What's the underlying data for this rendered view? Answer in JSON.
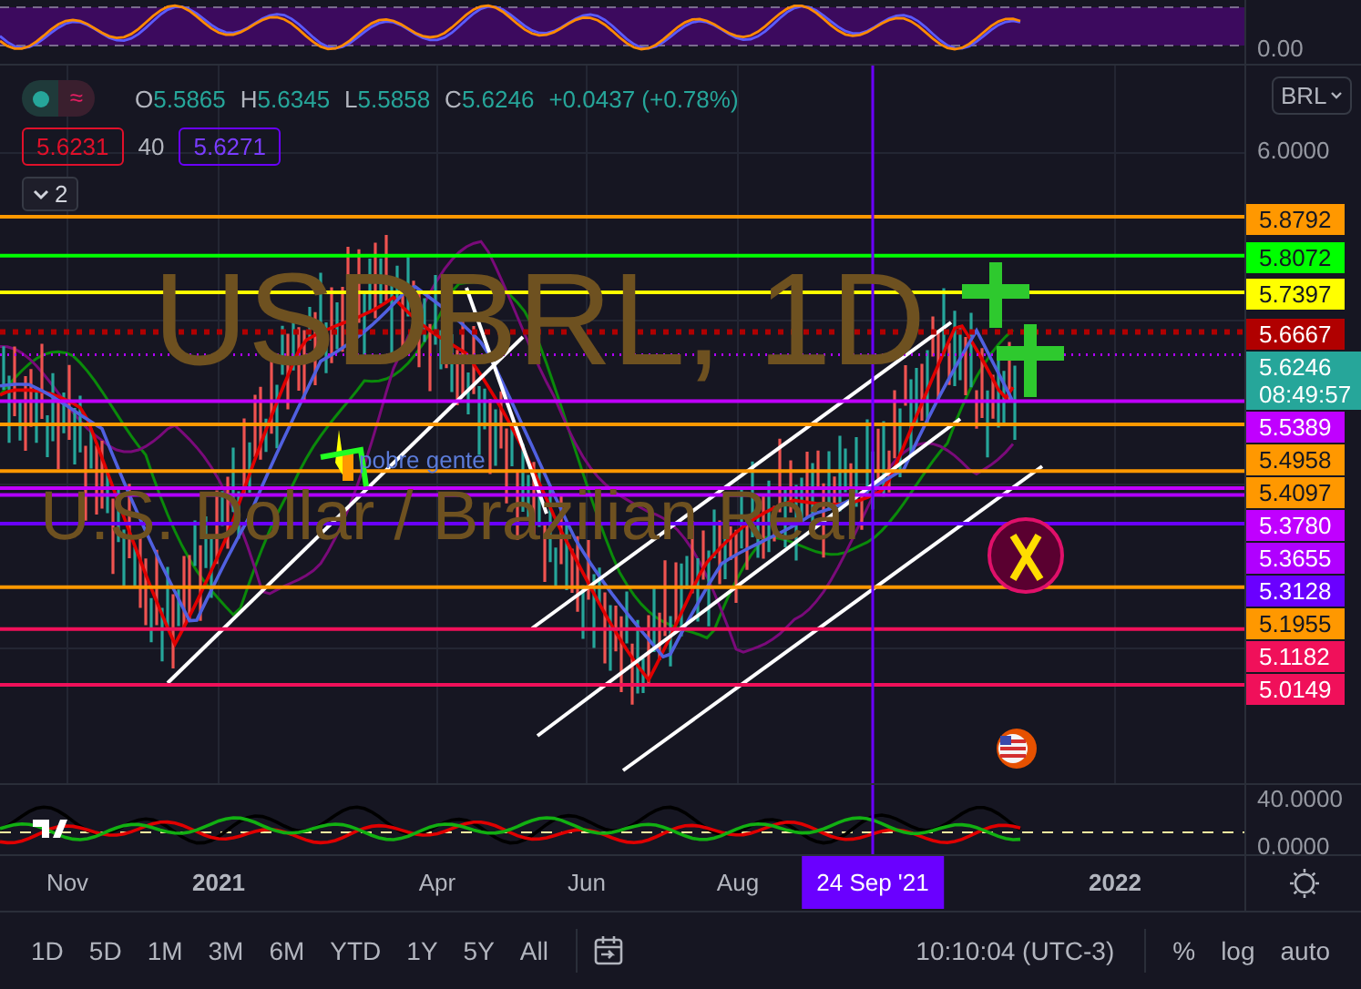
{
  "oscillator": {
    "axis_label": "0.00"
  },
  "legend": {
    "toggle_symbol": "≈",
    "ohlc": [
      {
        "label": "O",
        "value": "5.5865"
      },
      {
        "label": "H",
        "value": "5.6345"
      },
      {
        "label": "L",
        "value": "5.5858"
      },
      {
        "label": "C",
        "value": "5.6246"
      }
    ],
    "change": "+0.0437 (+0.78%)",
    "bid": "5.6231",
    "spread": "40",
    "ask": "5.6271",
    "collapse_count": "2"
  },
  "symbol_watermark": {
    "ticker": "USDBRL, 1D",
    "description": "U.S. Dollar / Brazilian Real"
  },
  "drawing_label": "pobre gente",
  "price_axis": {
    "currency": "BRL",
    "top_label": "6.0000"
  },
  "price_levels": [
    {
      "price": "5.8792",
      "color": "#ff9800",
      "kind": "solid"
    },
    {
      "price": "5.8072",
      "color": "#00ff00",
      "kind": "solid"
    },
    {
      "price": "5.7397",
      "color": "#ffff00",
      "kind": "solid"
    },
    {
      "price": "5.6667",
      "color": "#b00000",
      "kind": "dotted"
    },
    {
      "price": "5.5389",
      "color": "#c000ff",
      "kind": "solid"
    },
    {
      "price": "5.4958",
      "color": "#ff9800",
      "kind": "solid"
    },
    {
      "price": "5.4097",
      "color": "#ff9800",
      "kind": "solid"
    },
    {
      "price": "5.3780",
      "color": "#c000ff",
      "kind": "solid"
    },
    {
      "price": "5.3655",
      "color": "#b000ff",
      "kind": "solid"
    },
    {
      "price": "5.3128",
      "color": "#6a00ff",
      "kind": "solid"
    },
    {
      "price": "5.1955",
      "color": "#ff9800",
      "kind": "solid"
    },
    {
      "price": "5.1182",
      "color": "#f0105a",
      "kind": "solid"
    },
    {
      "price": "5.0149",
      "color": "#f0105a",
      "kind": "solid"
    }
  ],
  "current_price": {
    "price": "5.6246",
    "countdown": "08:49:57",
    "color": "#26a69a"
  },
  "lower_pane": {
    "axis_labels": [
      "40.0000",
      "0.0000"
    ]
  },
  "time_axis": [
    {
      "label": "Nov",
      "major": false
    },
    {
      "label": "2021",
      "major": true
    },
    {
      "label": "Apr",
      "major": false
    },
    {
      "label": "Jun",
      "major": false
    },
    {
      "label": "Aug",
      "major": false
    },
    {
      "label": "2022",
      "major": true
    }
  ],
  "crosshair": {
    "date": "24 Sep '21"
  },
  "toolbar": {
    "ranges": [
      "1D",
      "5D",
      "1M",
      "3M",
      "6M",
      "YTD",
      "1Y",
      "5Y",
      "All"
    ],
    "time": "10:10:04 (UTC-3)",
    "scale_buttons": [
      "%",
      "log",
      "auto"
    ]
  }
}
